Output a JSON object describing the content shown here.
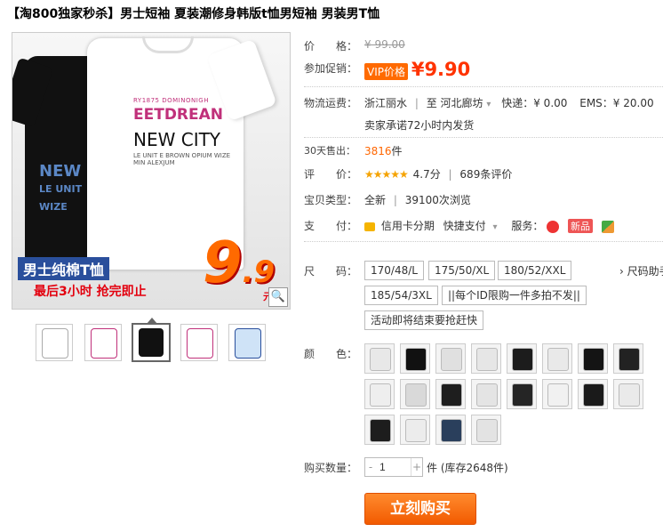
{
  "title": "【淘800独家秒杀】男士短袖 夏装潮修身韩版t恤男短袖 男装男T恤",
  "image": {
    "black_print": [
      "NEW",
      "LE UNIT",
      "WIZE"
    ],
    "white_print": {
      "line1": "RY1875 DOMINONIGH",
      "line2": "EETDREAN",
      "line3": "NEW CITY",
      "line4": "LE UNIT  E BROWN  OPIUM  WIZE  MIN  ALEXJUM"
    },
    "promo_line1": "男士纯棉T恤",
    "promo_line2": "最后3小时  抢完即止",
    "promo_num": "9",
    "promo_num_small": ".9",
    "promo_unit": "元包",
    "zoom_icon": "magnifier-icon"
  },
  "thumbs": [
    {
      "color": "#ffffff",
      "accent": "#222"
    },
    {
      "color": "#ffffff",
      "accent": "#c0307a"
    },
    {
      "color": "#111111",
      "accent": "#ffffff"
    },
    {
      "color": "#ffffff",
      "accent": "#c0307a"
    },
    {
      "color": "#cfe3f7",
      "accent": "#2a4f9c"
    }
  ],
  "price": {
    "label": "价　　格：",
    "value": "¥ 99.00"
  },
  "promo": {
    "label": "参加促销：",
    "badge": "VIP价格",
    "value": "¥9.90"
  },
  "shipping": {
    "label": "物流运费：",
    "from": "浙江丽水",
    "to": "至  河北廊坊",
    "express": "快递：¥ 0.00",
    "ems": "EMS：¥ 20.00",
    "promise": "卖家承诺72小时内发货"
  },
  "sales": {
    "label": "30天售出：",
    "count": "3816",
    "unit": "件"
  },
  "rating": {
    "label": "评　　价：",
    "stars": "★★★★★",
    "score": "4.7分",
    "reviews": "689条评价"
  },
  "type": {
    "label": "宝贝类型：",
    "condition": "全新",
    "views": "39100次浏览"
  },
  "pay": {
    "label": "支　　付：",
    "credit": "信用卡分期",
    "quick": "快捷支付",
    "service_label": "服务：",
    "new_badge": "新品"
  },
  "size": {
    "label": "尺　　码：",
    "options": [
      "170/48/L",
      "175/50/XL",
      "180/52/XXL",
      "185/54/3XL",
      "||每个ID限购一件多拍不发||",
      "活动即将结束要抢赶快"
    ],
    "guide": "› 尺码助手"
  },
  "color": {
    "label": "颜　　色：",
    "swatches": [
      "#e8e8e8",
      "#111111",
      "#e0e0e0",
      "#e6e6e6",
      "#1c1c1c",
      "#e9e9e9",
      "#141414",
      "#222222",
      "#eeeeee",
      "#d9d9d9",
      "#1e1e1e",
      "#e4e4e4",
      "#252525",
      "#f1f1f1",
      "#1a1a1a",
      "#eaeaea",
      "#1d1d1d",
      "#ececec",
      "#2a3f5c",
      "#e3e3e3"
    ]
  },
  "qty": {
    "label": "购买数量：",
    "value": "1",
    "stock": "件 (库存2648件)"
  },
  "buy_label": "立刻购买"
}
